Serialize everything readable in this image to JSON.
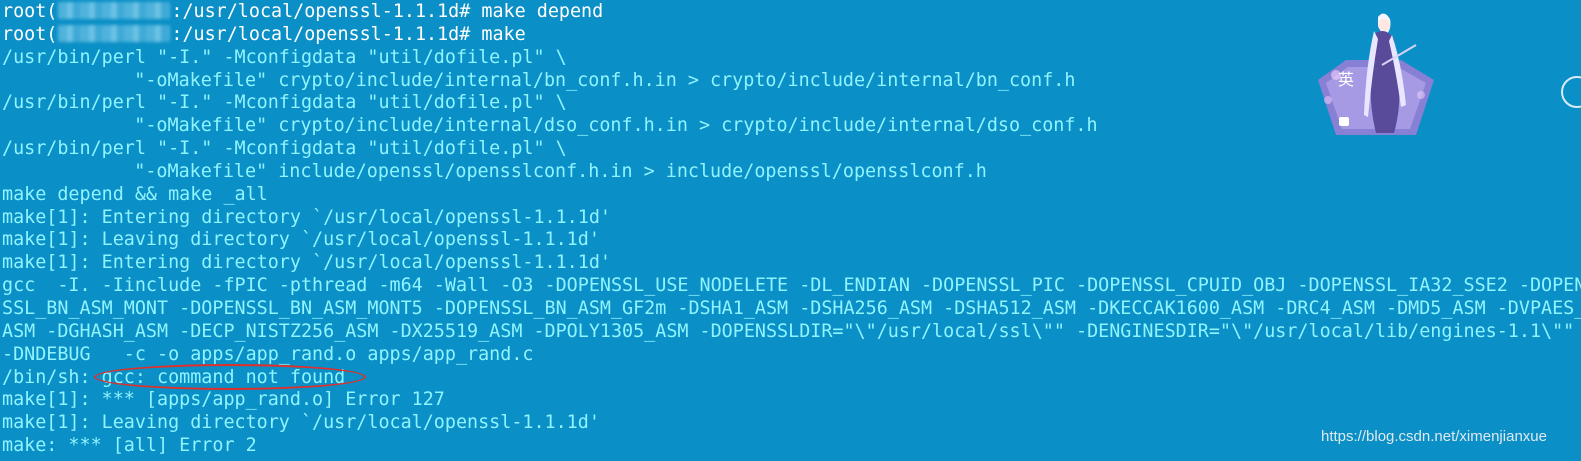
{
  "terminal": {
    "prompt_path": ":/usr/local/openssl-1.1.1d#",
    "user_prefix": "root(",
    "lines": [
      "/usr/bin/perl \"-I.\" -Mconfigdata \"util/dofile.pl\" \\",
      "    \"-oMakefile\" crypto/include/internal/bn_conf.h.in > crypto/include/internal/bn_conf.h",
      "/usr/bin/perl \"-I.\" -Mconfigdata \"util/dofile.pl\" \\",
      "    \"-oMakefile\" crypto/include/internal/dso_conf.h.in > crypto/include/internal/dso_conf.h",
      "/usr/bin/perl \"-I.\" -Mconfigdata \"util/dofile.pl\" \\",
      "    \"-oMakefile\" include/openssl/opensslconf.h.in > include/openssl/opensslconf.h",
      "make depend && make _all",
      "make[1]: Entering directory `/usr/local/openssl-1.1.1d'",
      "make[1]: Leaving directory `/usr/local/openssl-1.1.1d'",
      "make[1]: Entering directory `/usr/local/openssl-1.1.1d'",
      "gcc  -I. -Iinclude -fPIC -pthread -m64 -Wall -O3 -DOPENSSL_USE_NODELETE -DL_ENDIAN -DOPENSSL_PIC -DOPENSSL_CPUID_OBJ -DOPENSSL_IA32_SSE2 -DOPEN",
      "SSL_BN_ASM_MONT -DOPENSSL_BN_ASM_MONT5 -DOPENSSL_BN_ASM_GF2m -DSHA1_ASM -DSHA256_ASM -DSHA512_ASM -DKECCAK1600_ASM -DRC4_ASM -DMD5_ASM -DVPAES_",
      "ASM -DGHASH_ASM -DECP_NISTZ256_ASM -DX25519_ASM -DPOLY1305_ASM -DOPENSSLDIR=\"\\\"/usr/local/ssl\\\"\" -DENGINESDIR=\"\\\"/usr/local/lib/engines-1.1\\\"\"",
      "-DNDEBUG   -c -o apps/app_rand.o apps/app_rand.c"
    ],
    "commands": {
      "first": " make depend",
      "second": " make"
    },
    "error": {
      "prefix": "/bin/sh: ",
      "message": "gcc: command not found"
    },
    "tail_lines": [
      "make[1]: *** [apps/app_rand.o] Error 127",
      "make[1]: Leaving directory `/usr/local/openssl-1.1.1d'",
      "make: *** [all] Error 2"
    ]
  },
  "avatar": {
    "badge_char": "英"
  },
  "watermark": "https://blog.csdn.net/ximenjianxue",
  "colors": {
    "background": "#0a8fc6",
    "text": "#ffffff",
    "output_text": "#8ff4ff",
    "highlight": "#e0302b"
  }
}
